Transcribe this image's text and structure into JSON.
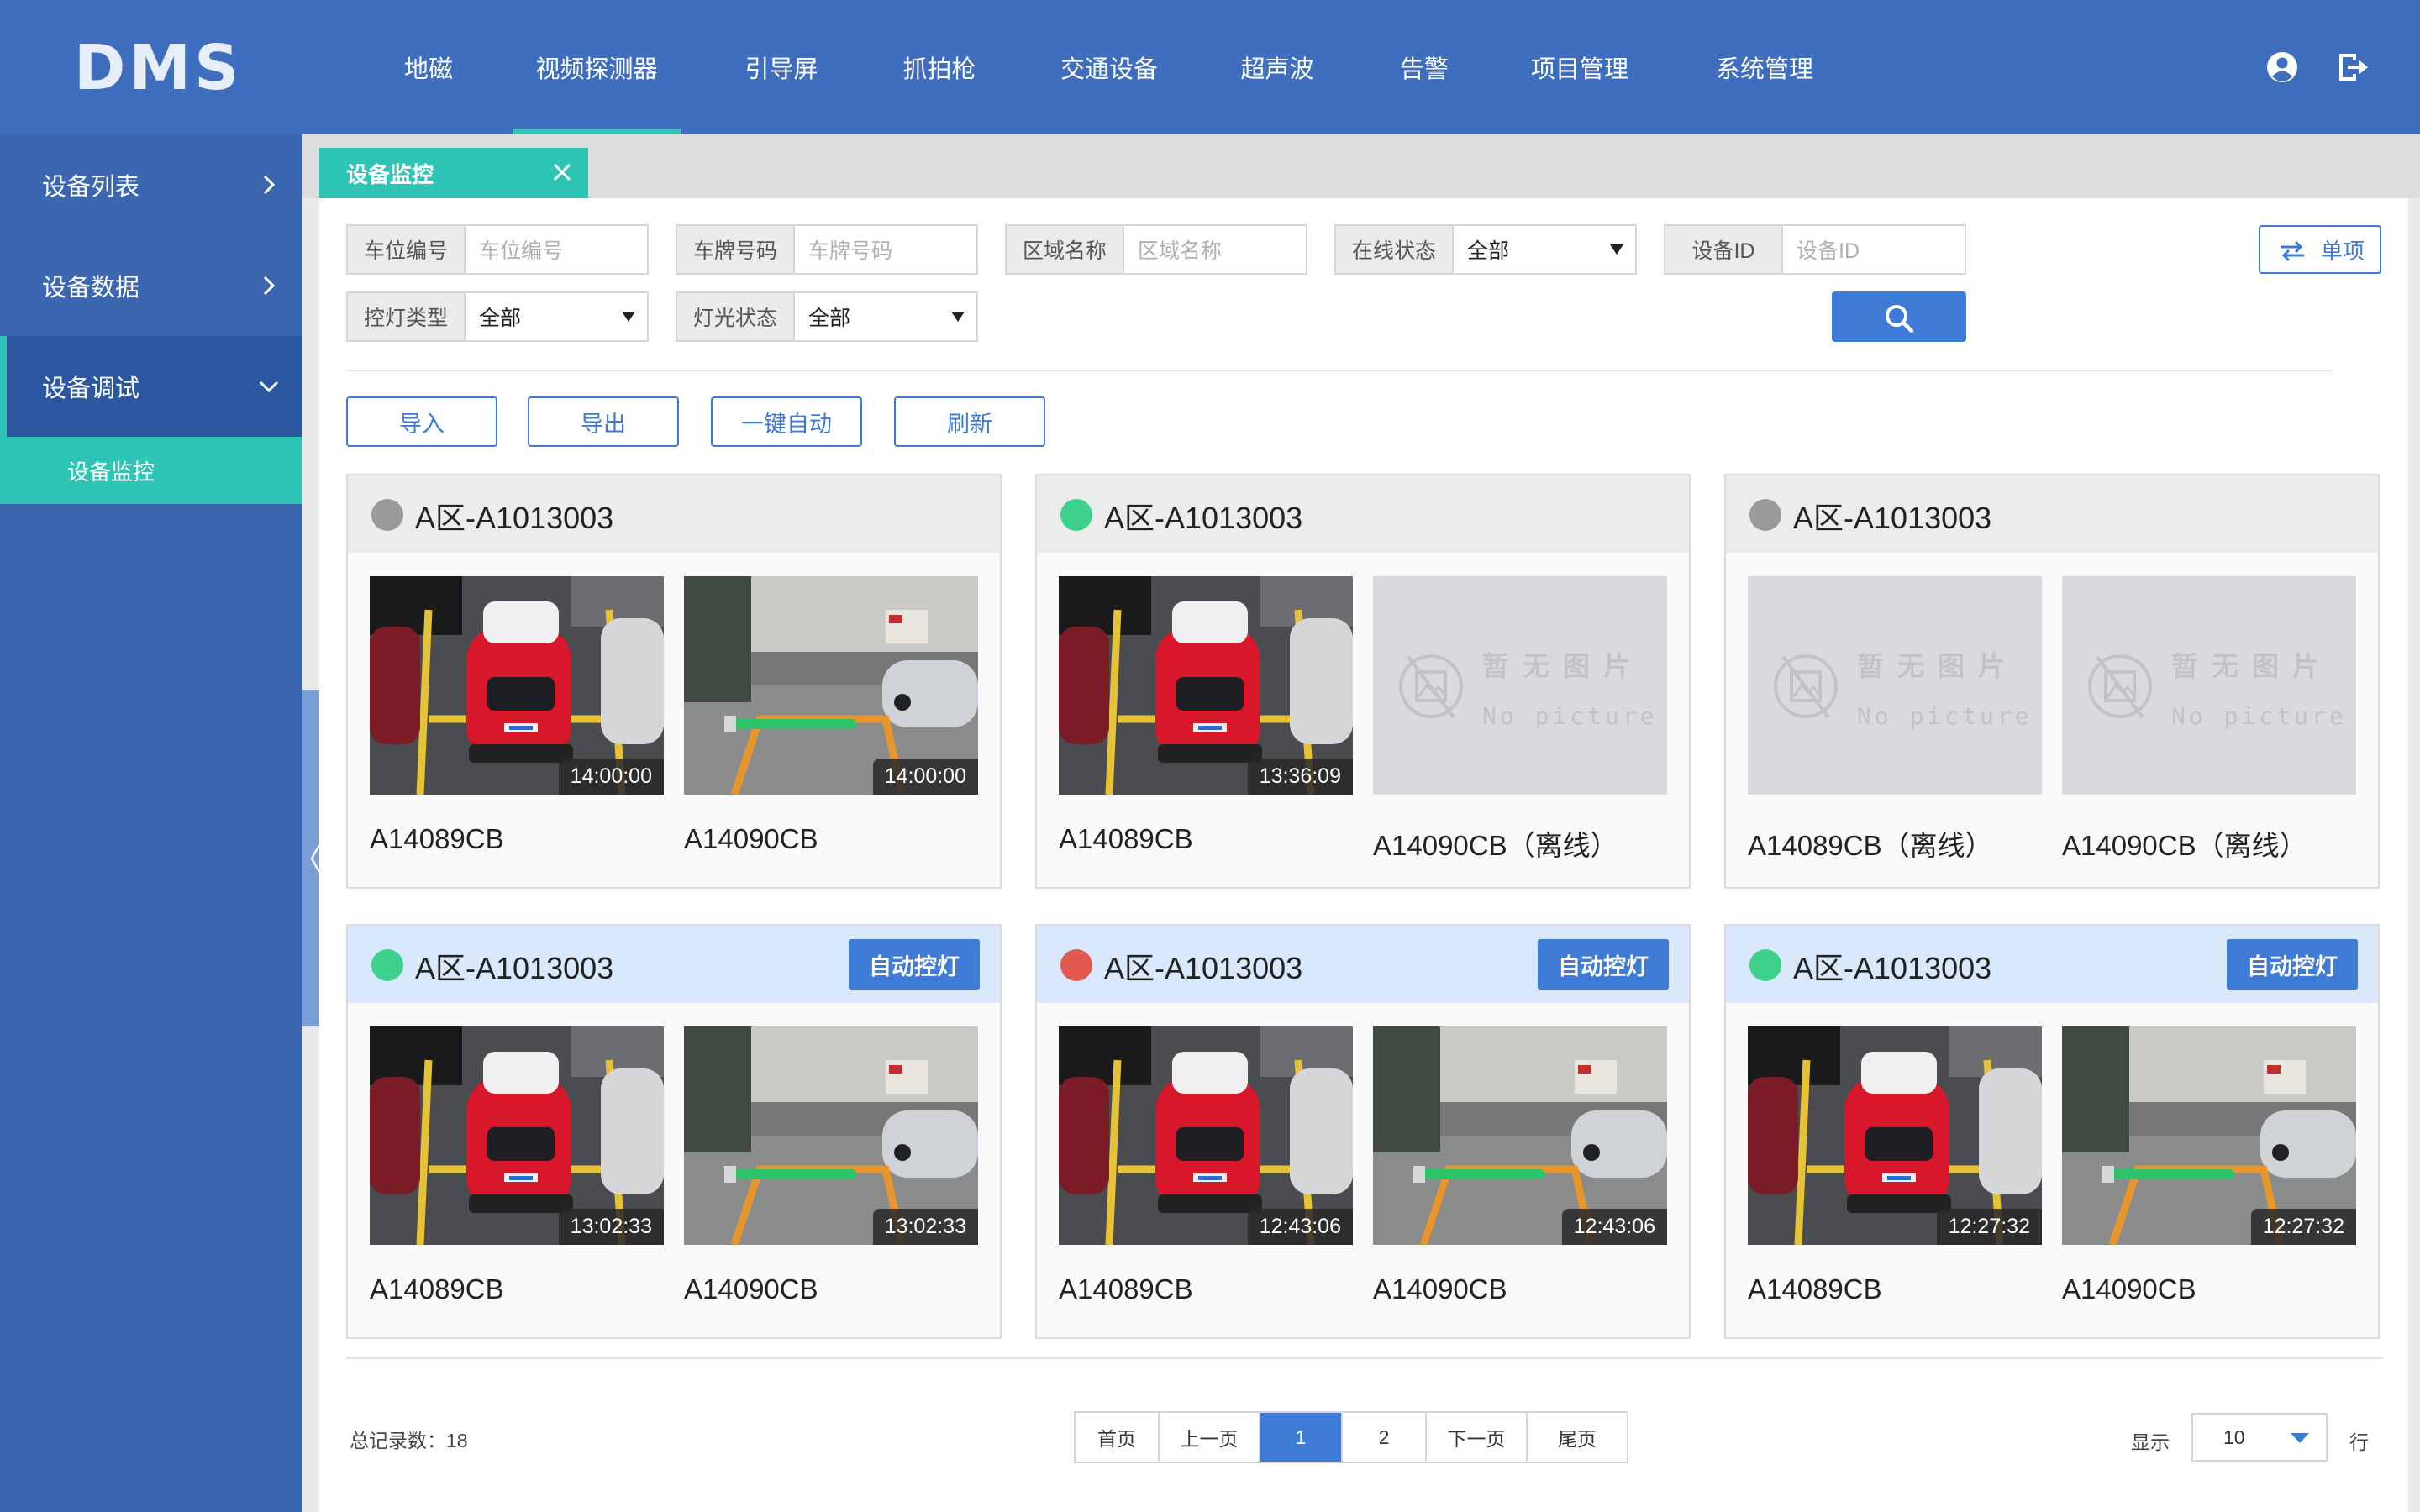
{
  "app": {
    "logo": "DMS"
  },
  "nav": [
    {
      "label": "地磁"
    },
    {
      "label": "视频探测器"
    },
    {
      "label": "引导屏"
    },
    {
      "label": "抓拍枪"
    },
    {
      "label": "交通设备"
    },
    {
      "label": "超声波"
    },
    {
      "label": "告警"
    },
    {
      "label": "项目管理"
    },
    {
      "label": "系统管理"
    }
  ],
  "nav_active": "视频探测器",
  "sidebar": {
    "items": [
      {
        "label": "设备列表"
      },
      {
        "label": "设备数据"
      },
      {
        "label": "设备调试"
      }
    ],
    "sub_item": "设备监控"
  },
  "tab": {
    "label": "设备监控"
  },
  "filters": {
    "spot_no": {
      "label": "车位编号",
      "placeholder": "车位编号"
    },
    "plate_no": {
      "label": "车牌号码",
      "placeholder": "车牌号码"
    },
    "area_name": {
      "label": "区域名称",
      "placeholder": "区域名称"
    },
    "online_status": {
      "label": "在线状态",
      "value": "全部"
    },
    "device_id": {
      "label": "设备ID",
      "placeholder": "设备ID"
    },
    "light_ctrl_type": {
      "label": "控灯类型",
      "value": "全部"
    },
    "light_status": {
      "label": "灯光状态",
      "value": "全部"
    }
  },
  "single_button": "单项",
  "actions": [
    "导入",
    "导出",
    "一键自动",
    "刷新"
  ],
  "colors": {
    "online": "#3dd18c",
    "offline": "#9a9a9a",
    "alarm": "#e25a4f",
    "accent": "#3e7bd6",
    "teal": "#2ec4b6"
  },
  "cards": [
    {
      "title": "A区-A1013003",
      "status": "offline",
      "auto_light": "",
      "devices": [
        {
          "name": "A14089CB",
          "time": "14:00:00",
          "pic": "car"
        },
        {
          "name": "A14090CB",
          "time": "14:00:00",
          "pic": "bay"
        }
      ]
    },
    {
      "title": "A区-A1013003",
      "status": "online",
      "auto_light": "",
      "devices": [
        {
          "name": "A14089CB",
          "time": "13:36:09",
          "pic": "car"
        },
        {
          "name": "A14090CB（离线）",
          "time": "",
          "pic": "none"
        }
      ]
    },
    {
      "title": "A区-A1013003",
      "status": "offline",
      "auto_light": "",
      "devices": [
        {
          "name": "A14089CB（离线）",
          "time": "",
          "pic": "none"
        },
        {
          "name": "A14090CB（离线）",
          "time": "",
          "pic": "none"
        }
      ]
    },
    {
      "title": "A区-A1013003",
      "status": "online",
      "auto_light": "自动控灯",
      "devices": [
        {
          "name": "A14089CB",
          "time": "13:02:33",
          "pic": "car"
        },
        {
          "name": "A14090CB",
          "time": "13:02:33",
          "pic": "bay"
        }
      ]
    },
    {
      "title": "A区-A1013003",
      "status": "alarm",
      "auto_light": "自动控灯",
      "devices": [
        {
          "name": "A14089CB",
          "time": "12:43:06",
          "pic": "car"
        },
        {
          "name": "A14090CB",
          "time": "12:43:06",
          "pic": "bay"
        }
      ]
    },
    {
      "title": "A区-A1013003",
      "status": "online",
      "auto_light": "自动控灯",
      "devices": [
        {
          "name": "A14089CB",
          "time": "12:27:32",
          "pic": "car"
        },
        {
          "name": "A14090CB",
          "time": "12:27:32",
          "pic": "bay"
        }
      ]
    }
  ],
  "no_picture": {
    "cn": "暂无图片",
    "en": "No picture"
  },
  "pagination": {
    "total_label": "总记录数：18",
    "buttons": [
      "首页",
      "上一页",
      "1",
      "2",
      "下一页",
      "尾页"
    ],
    "current": "1",
    "show_label": "显示",
    "page_size": "10",
    "rows_unit": "行"
  }
}
